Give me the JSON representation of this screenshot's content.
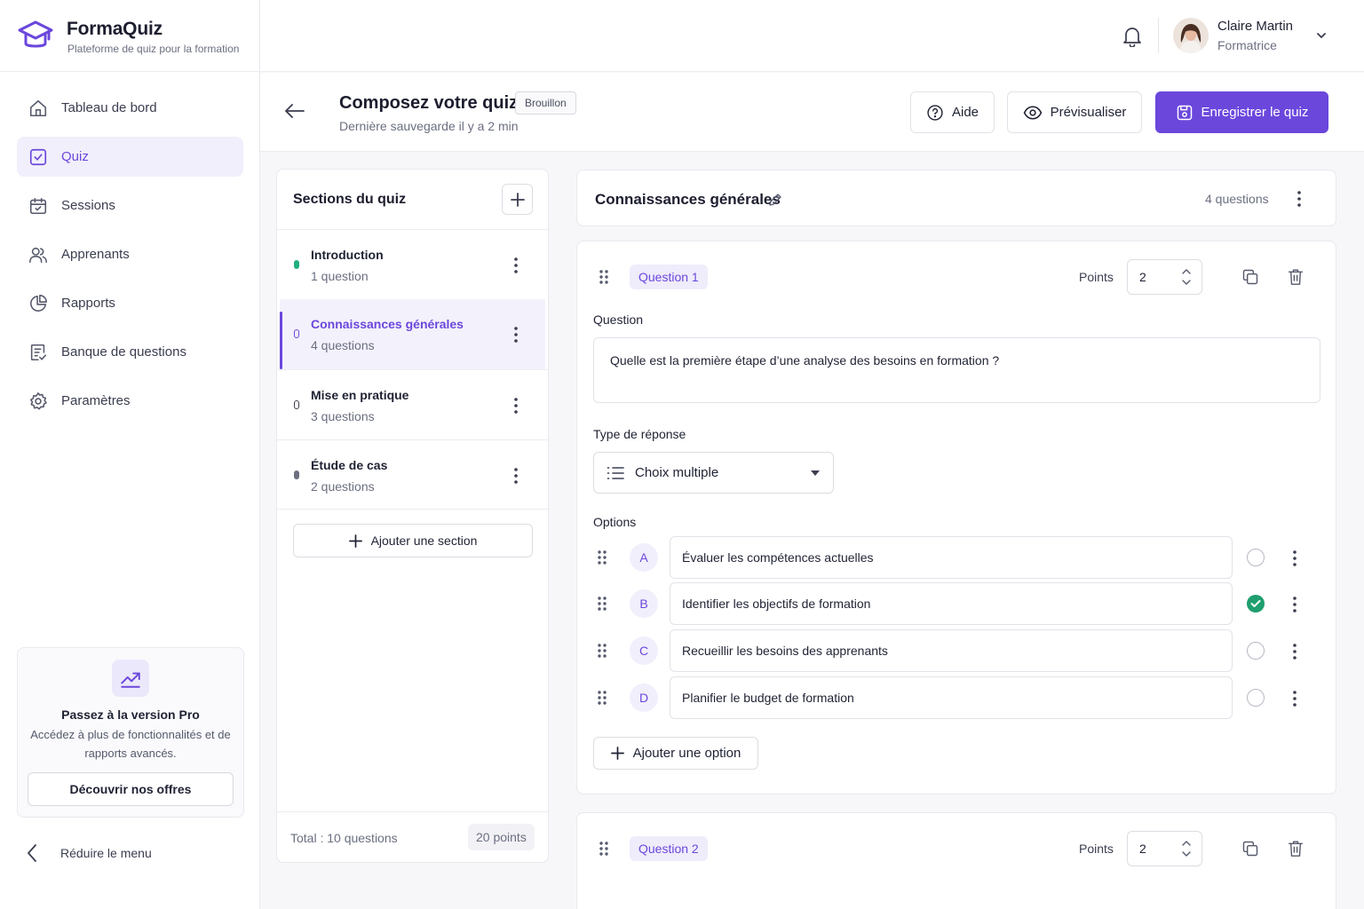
{
  "brand": {
    "name": "FormaQuiz",
    "tagline": "Plateforme de quiz pour la formation"
  },
  "nav": {
    "items": [
      {
        "label": "Tableau de bord",
        "icon": "home-icon",
        "active": false
      },
      {
        "label": "Quiz",
        "icon": "checkbox-icon",
        "active": true
      },
      {
        "label": "Sessions",
        "icon": "calendar-icon",
        "active": false
      },
      {
        "label": "Apprenants",
        "icon": "users-icon",
        "active": false
      },
      {
        "label": "Rapports",
        "icon": "pie-chart-icon",
        "active": false
      },
      {
        "label": "Banque de questions",
        "icon": "question-bank-icon",
        "active": false
      },
      {
        "label": "Paramètres",
        "icon": "gear-icon",
        "active": false
      }
    ]
  },
  "promo": {
    "title": "Passez à la version Pro",
    "description": "Accédez à plus de fonctionnalités et de rapports avancés.",
    "button": "Découvrir nos offres"
  },
  "collapse_label": "Réduire le menu",
  "user": {
    "name": "Claire Martin",
    "role": "Formatrice"
  },
  "header": {
    "title": "Composez votre quiz",
    "badge": "Brouillon",
    "last_save": "Dernière sauvegarde il y a 2 min",
    "help_label": "Aide",
    "preview_label": "Prévisualiser",
    "save_label": "Enregistrer le quiz"
  },
  "sections_panel": {
    "title": "Sections du quiz",
    "items": [
      {
        "name": "Introduction",
        "count": "1 question",
        "dot_color": "#22b07d"
      },
      {
        "name": "Connaissances générales",
        "count": "4 questions",
        "dot_color": "#6b47dc"
      },
      {
        "name": "Mise en pratique",
        "count": "3 questions",
        "dot_color": "#3a3d4f"
      },
      {
        "name": "Étude de cas",
        "count": "2 questions",
        "dot_color": "#6b6f80"
      }
    ],
    "add_label": "Ajouter une section",
    "total_label": "Total : 10 questions",
    "total_points": "20 points"
  },
  "section": {
    "title": "Connaissances générales",
    "count": "4 questions"
  },
  "questions": [
    {
      "label": "Question 1",
      "points_label": "Points",
      "points": "2",
      "field_label": "Question",
      "text": "Quelle est la première étape d’une analyse des besoins en formation ?",
      "type_label": "Type de réponse",
      "type_value": "Choix multiple",
      "options_label": "Options",
      "options": [
        {
          "letter": "A",
          "text": "Évaluer les compétences actuelles",
          "correct": false
        },
        {
          "letter": "B",
          "text": "Identifier les objectifs de formation",
          "correct": true
        },
        {
          "letter": "C",
          "text": "Recueillir les besoins des apprenants",
          "correct": false
        },
        {
          "letter": "D",
          "text": "Planifier le budget de formation",
          "correct": false
        }
      ],
      "add_option_label": "Ajouter une option"
    },
    {
      "label": "Question 2",
      "points_label": "Points",
      "points": "2"
    }
  ],
  "colors": {
    "accent": "#6b47dc",
    "correct": "#1f9e6e",
    "accent_soft": "#f1effb"
  }
}
